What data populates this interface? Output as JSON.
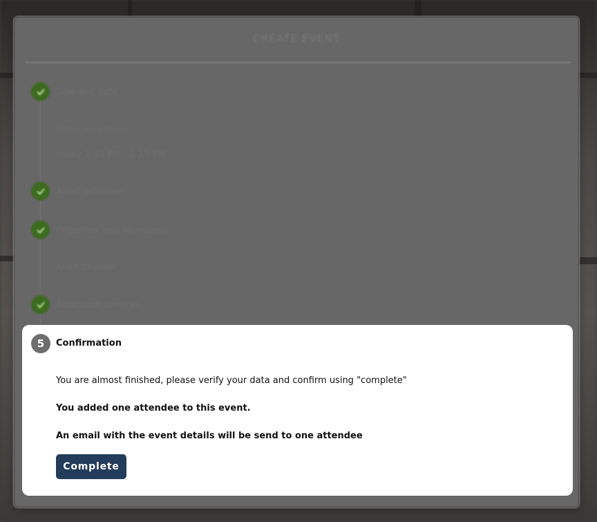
{
  "dialog": {
    "title": "CREATE EVENT"
  },
  "steps": [
    {
      "label": "Title and date",
      "status": "complete",
      "detail_heading": "Date and time",
      "detail_value": "today 1:15 PM - 2:15 PM"
    },
    {
      "label": "Asset selection",
      "status": "complete"
    },
    {
      "label": "Organiser and attendees",
      "status": "complete",
      "detail_value": "Allan Chester"
    },
    {
      "label": "Additional services",
      "status": "complete"
    }
  ],
  "active_step": {
    "number": "5",
    "title": "Confirmation",
    "instruction": "You are almost finished, please verify your data and confirm using \"complete\"",
    "attendee_summary": "You added one attendee to this event.",
    "email_summary": "An email with the event details will be send to one attendee",
    "complete_label": "Complete"
  },
  "colors": {
    "check_green": "#3c6a1f",
    "button_navy": "#233c5b",
    "step_number_gray": "#6e6e6e"
  },
  "icons": {
    "step_complete": "check-icon"
  }
}
